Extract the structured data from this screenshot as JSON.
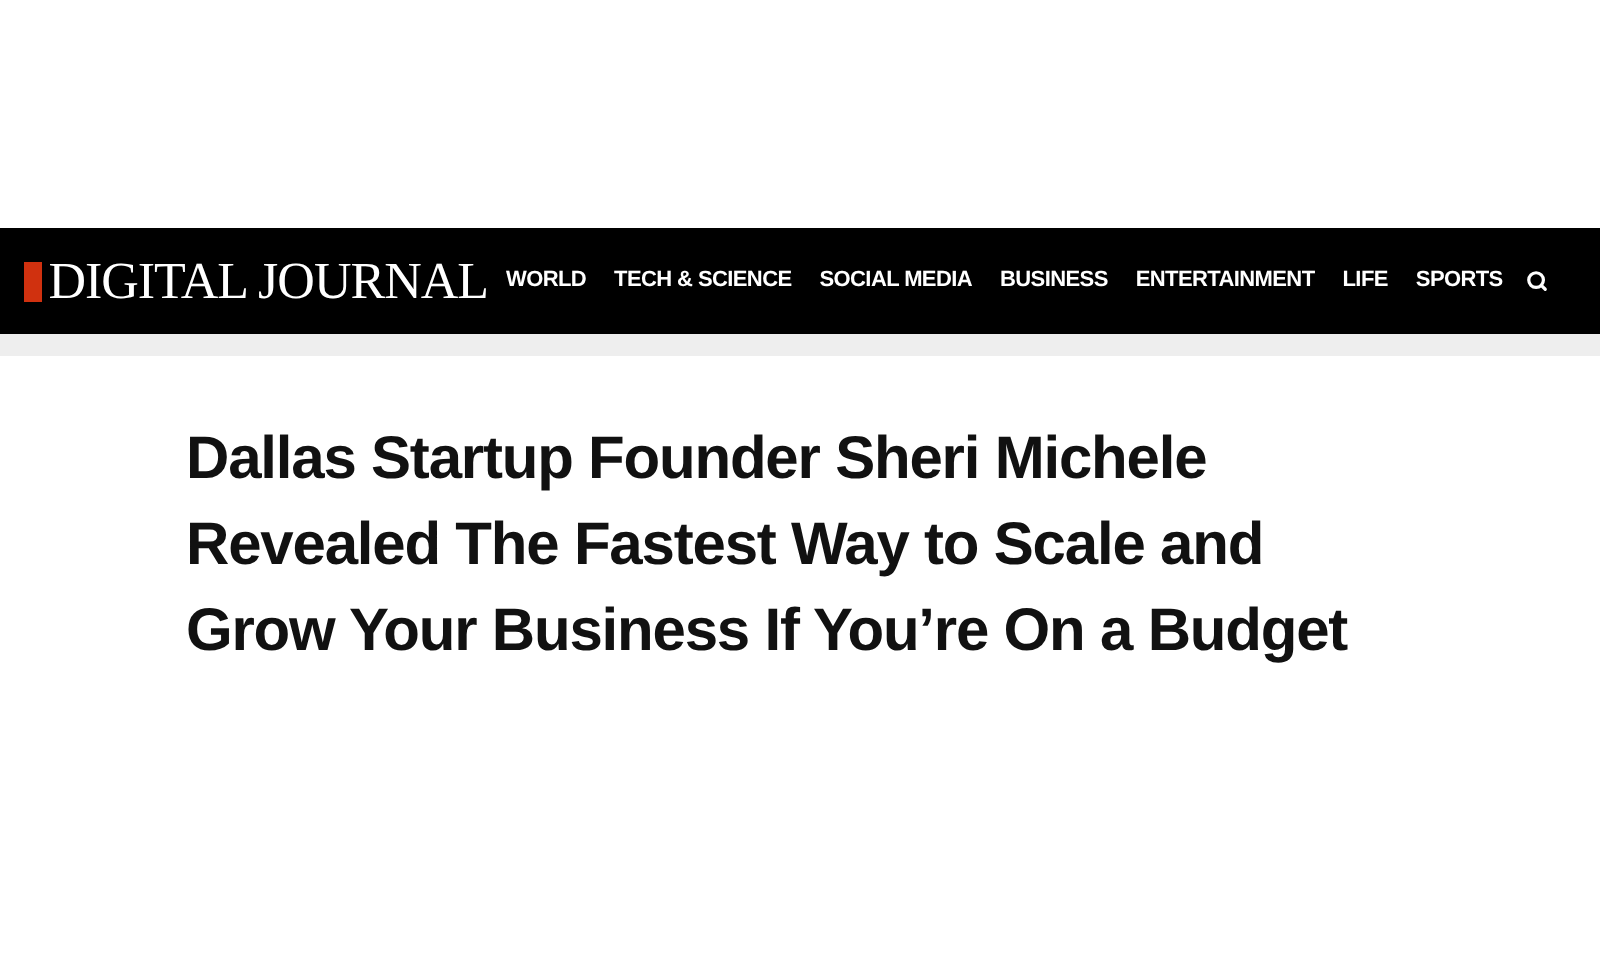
{
  "header": {
    "logo": "DIGITAL JOURNAL",
    "nav": [
      {
        "label": "WORLD"
      },
      {
        "label": "TECH & SCIENCE"
      },
      {
        "label": "SOCIAL MEDIA"
      },
      {
        "label": "BUSINESS"
      },
      {
        "label": "ENTERTAINMENT"
      },
      {
        "label": "LIFE"
      },
      {
        "label": "SPORTS"
      }
    ]
  },
  "article": {
    "headline": "Dallas Startup Founder Sheri Michele Revealed The Fastest Way to Scale and Grow Your Business If You’re On a Budget"
  }
}
